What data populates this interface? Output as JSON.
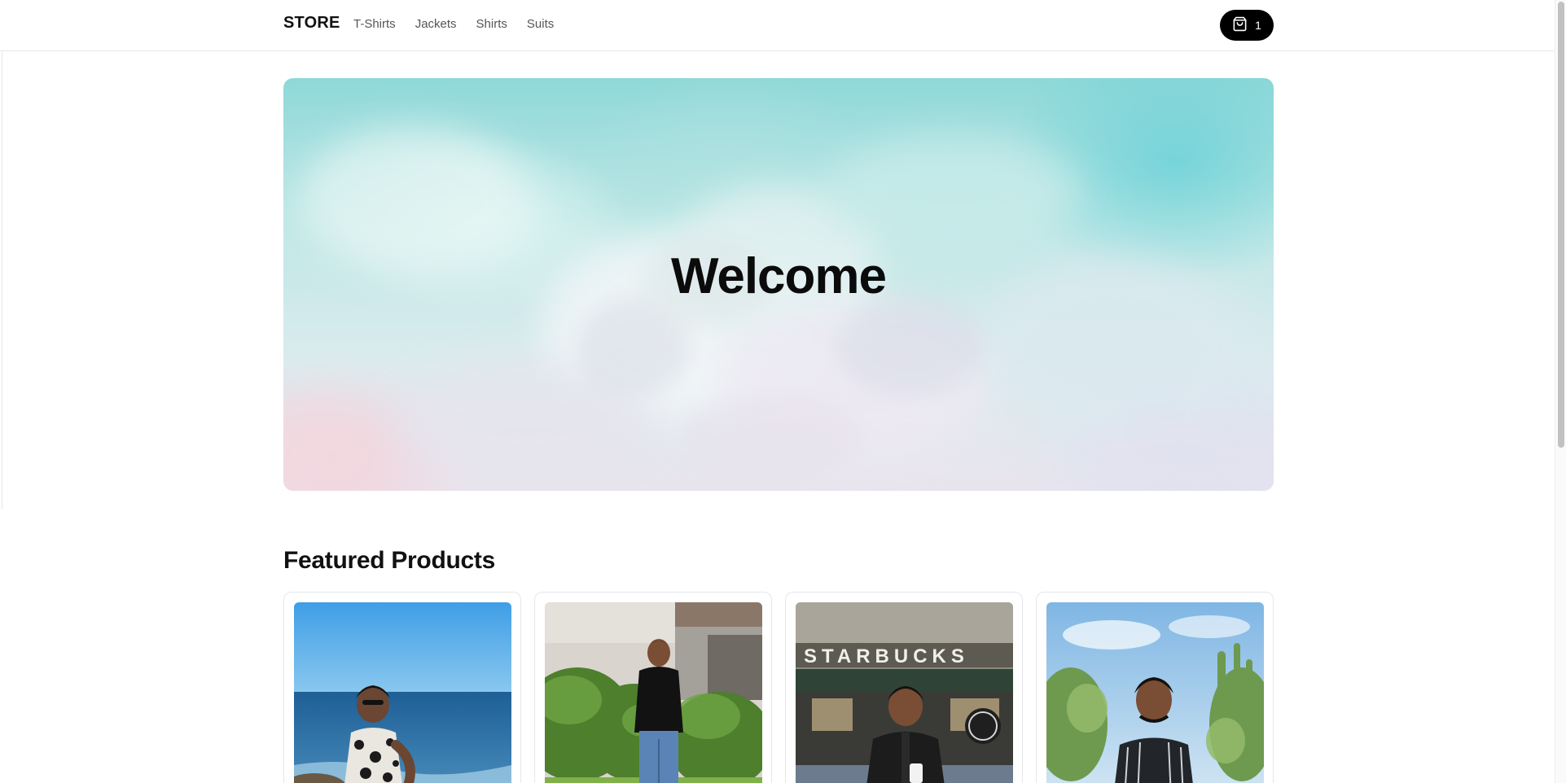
{
  "header": {
    "logo": "STORE",
    "nav": [
      {
        "label": "T-Shirts"
      },
      {
        "label": "Jackets"
      },
      {
        "label": "Shirts"
      },
      {
        "label": "Suits"
      }
    ],
    "cart": {
      "icon": "shopping-bag-icon",
      "count": "1"
    }
  },
  "hero": {
    "title": "Welcome"
  },
  "featured": {
    "title": "Featured Products",
    "products": [
      {
        "image": "product-photo-beach"
      },
      {
        "image": "product-photo-hedge"
      },
      {
        "image": "product-photo-cafe"
      },
      {
        "image": "product-photo-cactus"
      }
    ]
  },
  "colors": {
    "accent": "#000000",
    "border": "#e5e7eb",
    "nav_text": "#555555"
  }
}
